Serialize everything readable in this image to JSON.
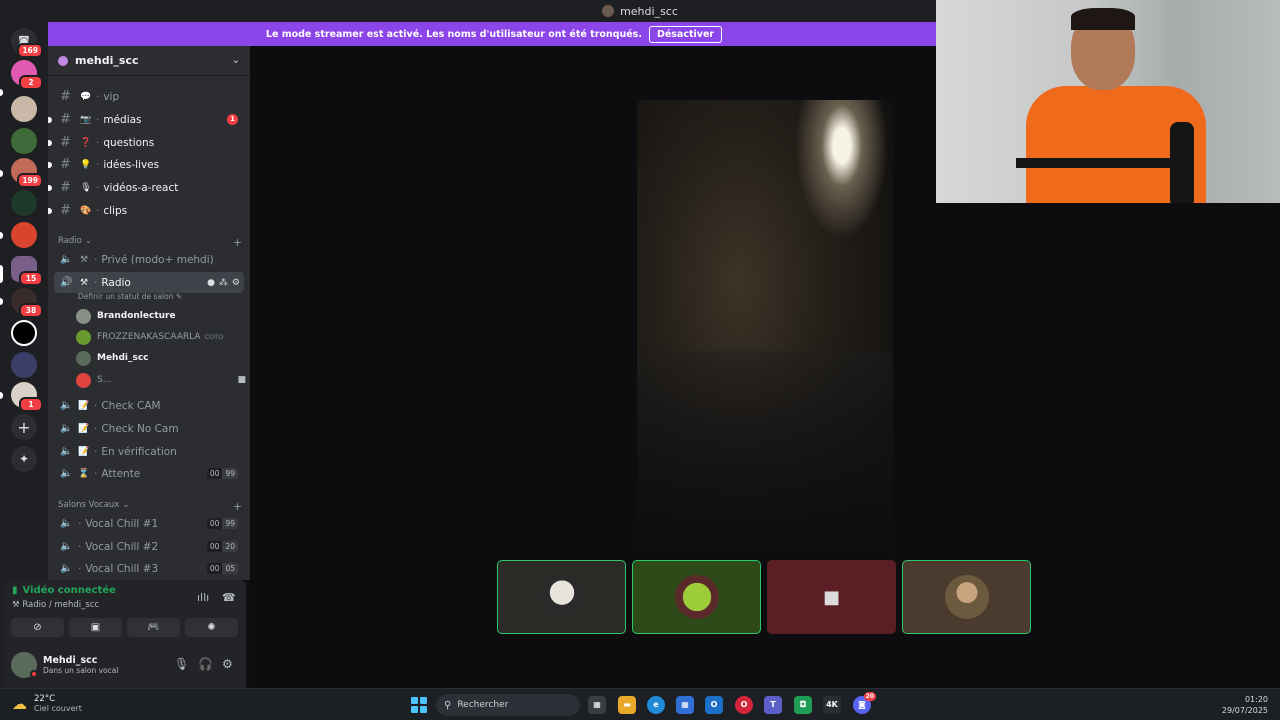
{
  "window": {
    "title": "mehdi_scc"
  },
  "banner": {
    "text": "Le mode streamer est activé. Les noms d'utilisateur ont été tronqués.",
    "button": "Désactiver"
  },
  "rail": {
    "badges": [
      "169",
      "2",
      "199",
      "15",
      "38",
      "1"
    ],
    "home_icon": "discord-icon",
    "add_icon": "plus-icon",
    "discover_icon": "compass-icon"
  },
  "server": {
    "name": "mehdi_scc"
  },
  "channels": [
    {
      "name": "vip",
      "emoji": "💬"
    },
    {
      "name": "médias",
      "emoji": "📷",
      "badge": "1"
    },
    {
      "name": "questions",
      "emoji": "❓"
    },
    {
      "name": "idées-lives",
      "emoji": "💡"
    },
    {
      "name": "vidéos-a-react",
      "emoji": "🎙"
    },
    {
      "name": "clips",
      "emoji": "🎨"
    }
  ],
  "categories": {
    "radio": "Radio",
    "voice": "Salons Vocaux"
  },
  "radio_channels": {
    "prive": "Privé (modo+ mehdi)",
    "radio": "Radio",
    "status_prompt": "Définir un statut de salon",
    "check_cam": "Check CAM",
    "check_no_cam": "Check No Cam",
    "verification": "En vérification",
    "attente": "Attente",
    "attente_limit": [
      "00",
      "99"
    ]
  },
  "voice_users": [
    {
      "name": "Brandonlecture"
    },
    {
      "name": "FROZZENAKASCAARLA",
      "tag": "COTO"
    },
    {
      "name": "Mehdi_scc"
    },
    {
      "name": "S..."
    }
  ],
  "voice_channels": [
    {
      "name": "Vocal Chill #1",
      "limit": [
        "00",
        "99"
      ]
    },
    {
      "name": "Vocal Chill #2",
      "limit": [
        "00",
        "20"
      ]
    },
    {
      "name": "Vocal Chill #3",
      "limit": [
        "00",
        "05"
      ]
    }
  ],
  "voice_panel": {
    "title": "Vidéo connectée",
    "subtitle": "Radio / mehdi_scc"
  },
  "user_panel": {
    "name": "Mehdi_scc",
    "status": "Dans un salon vocal"
  },
  "taskbar": {
    "temperature": "22°C",
    "weather": "Ciel couvert",
    "search_placeholder": "Rechercher",
    "time": "01:20",
    "date": "29/07/2025",
    "discord_badge": "20"
  },
  "colors": {
    "accent": "#8c45e8",
    "speaking": "#2dc770",
    "danger": "#f23f43",
    "connected": "#23a55a"
  }
}
